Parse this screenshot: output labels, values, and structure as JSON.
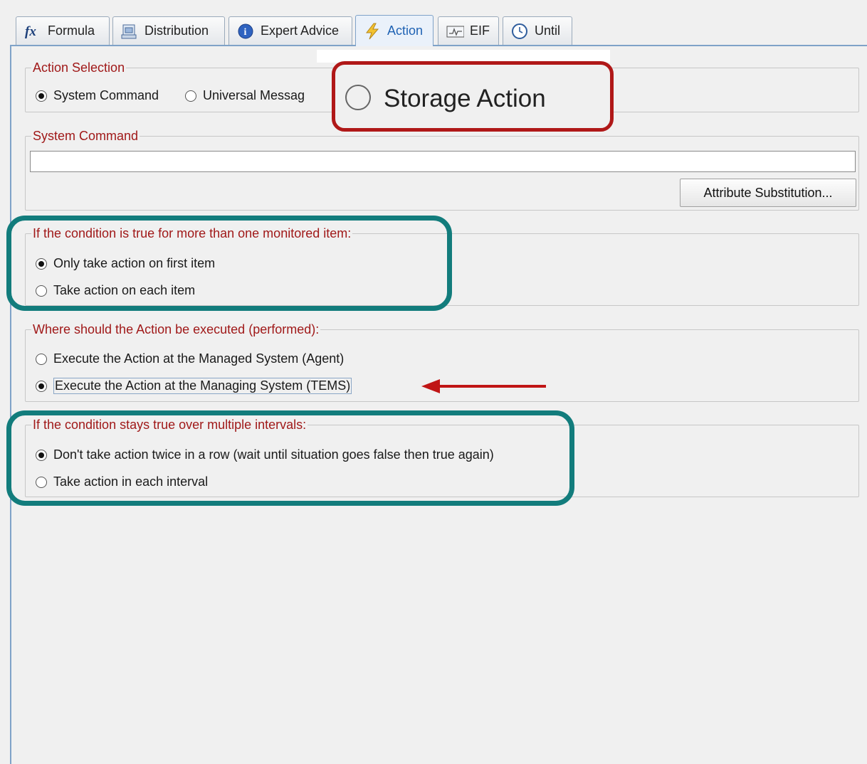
{
  "tabs": [
    {
      "label": "Formula",
      "icon": "fx-icon"
    },
    {
      "label": "Distribution",
      "icon": "distribution-icon"
    },
    {
      "label": "Expert Advice",
      "icon": "info-icon"
    },
    {
      "label": "Action",
      "icon": "lightning-icon",
      "active": true
    },
    {
      "label": "EIF",
      "icon": "eif-icon"
    },
    {
      "label": "Until",
      "icon": "clock-icon"
    }
  ],
  "action_selection": {
    "legend": "Action Selection",
    "system_command": "System Command",
    "universal_message": "Universal Messag",
    "selected": "System Command"
  },
  "storage_callout": {
    "label": "Storage Action"
  },
  "system_command": {
    "legend": "System Command",
    "value": "",
    "attribute_button": "Attribute Substitution..."
  },
  "multi_item": {
    "legend": "If the condition is true for more than one monitored item:",
    "option_first": "Only take action on first item",
    "option_each": "Take action on each item",
    "selected": "first"
  },
  "execute_where": {
    "legend": "Where should the Action be executed (performed):",
    "option_agent": "Execute the Action at the Managed System (Agent)",
    "option_tems": "Execute the Action at the Managing System (TEMS)",
    "selected": "tems"
  },
  "intervals": {
    "legend": "If the condition stays true over multiple intervals:",
    "option_once": "Don't take action twice in a row (wait until situation goes false then true again)",
    "option_each": "Take action in each interval",
    "selected": "once"
  },
  "colors": {
    "callout_red": "#b01818",
    "callout_teal": "#127c7c",
    "arrow": "#c01515",
    "legend_text": "#a01919"
  }
}
